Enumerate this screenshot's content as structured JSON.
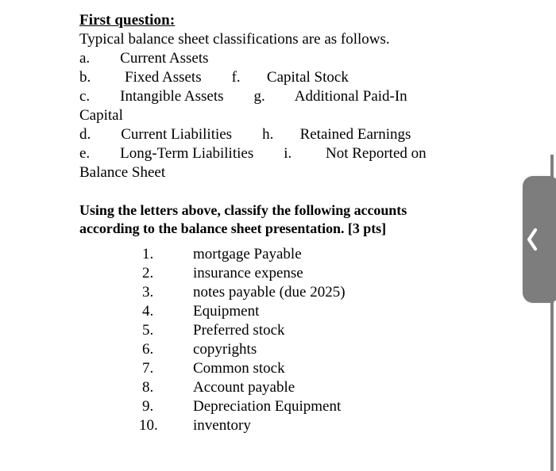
{
  "document": {
    "heading": "First question:",
    "lead": "Typical balance sheet classifications are as follows.",
    "classification_lines": [
      "a.        Current Assets",
      "b.         Fixed Assets        f.       Capital Stock",
      "c.        Intangible Assets        g.        Additional Paid-In",
      "Capital",
      "d.        Current Liabilities        h.       Retained Earnings",
      "e.        Long-Term Liabilities        i.         Not Reported on",
      "Balance Sheet"
    ],
    "prompt": "Using the letters above, classify the following accounts according to the balance sheet presentation. [3 pts]",
    "accounts": [
      {
        "num": "1.",
        "label": "mortgage Payable"
      },
      {
        "num": "2.",
        "label": "insurance expense"
      },
      {
        "num": "3.",
        "label": "notes payable (due 2025)"
      },
      {
        "num": "4.",
        "label": "Equipment"
      },
      {
        "num": "5.",
        "label": "Preferred stock"
      },
      {
        "num": "6.",
        "label": "copyrights"
      },
      {
        "num": "7.",
        "label": "Common stock"
      },
      {
        "num": "8.",
        "label": "Account payable"
      },
      {
        "num": "9.",
        "label": "Depreciation Equipment"
      },
      {
        "num": "10.",
        "label": " inventory"
      }
    ]
  },
  "sidebar_toggle": {
    "icon": "chevron-left-icon",
    "handle_color": "#7d7d7d",
    "chevron_color": "#ffffff",
    "divider_color": "#808080"
  }
}
